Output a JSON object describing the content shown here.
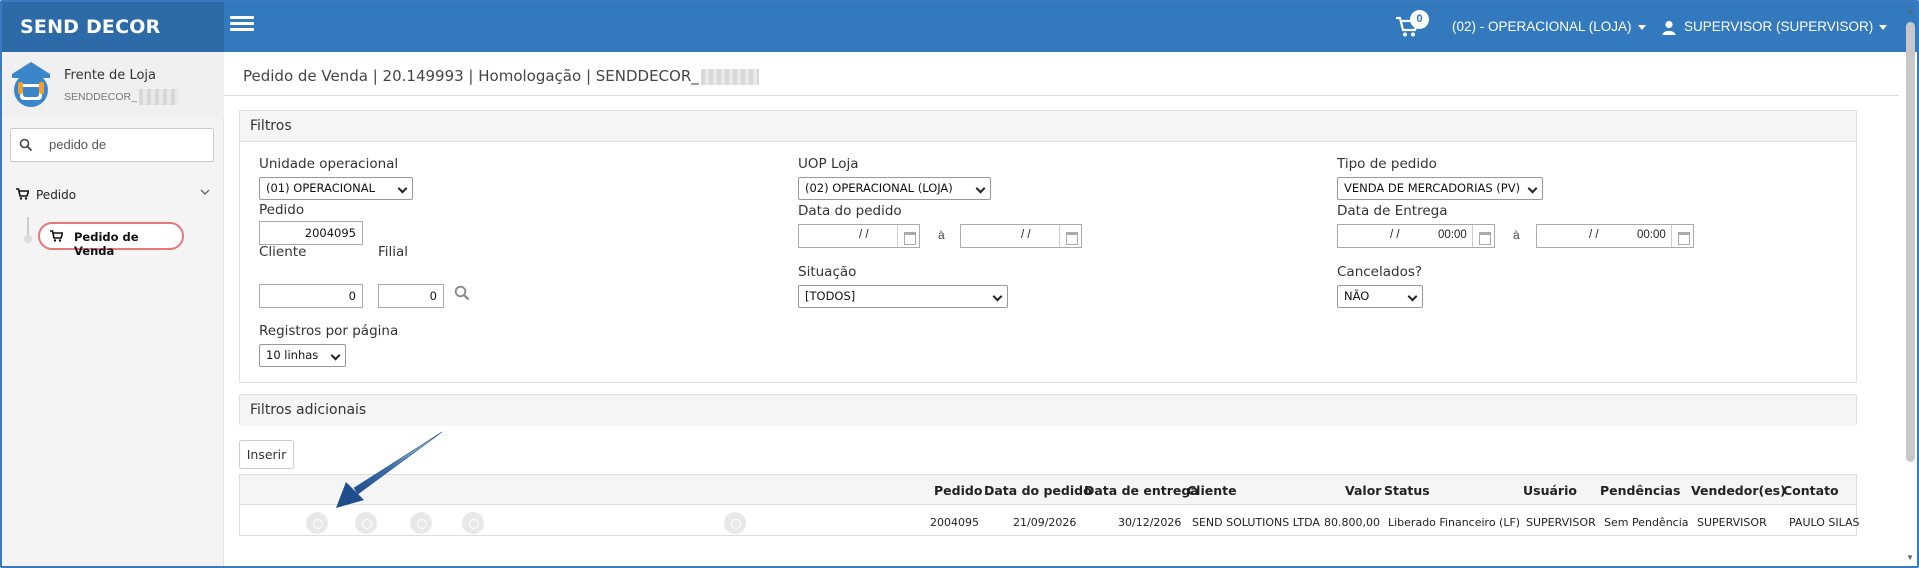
{
  "app": {
    "brand": "SEND DECOR"
  },
  "topbar": {
    "cart_count": "0",
    "uop": "(02) - OPERACIONAL (LOJA)",
    "user": "SUPERVISOR (SUPERVISOR)"
  },
  "sidebar": {
    "store_title": "Frente de Loja",
    "store_sub": "SENDDECOR_",
    "search_value": "pedido de",
    "group_label": "Pedido",
    "active_item": "Pedido de Venda"
  },
  "page": {
    "breadcrumb": "Pedido de Venda | 20.149993 | Homologação | SENDDECOR_"
  },
  "filters": {
    "title": "Filtros",
    "unidade_label": "Unidade operacional",
    "unidade_value": "(01) OPERACIONAL",
    "uop_loja_label": "UOP Loja",
    "uop_loja_value": "(02) OPERACIONAL (LOJA)",
    "tipo_label": "Tipo de pedido",
    "tipo_value": "VENDA DE MERCADORIAS (PV)",
    "pedido_label": "Pedido",
    "pedido_value": "2004095",
    "data_pedido_label": "Data do pedido",
    "date_placeholder": "/ /",
    "time_value": "00:00",
    "a_sep": "à",
    "data_entrega_label": "Data de Entrega",
    "cliente_label": "Cliente",
    "cliente_value": "0",
    "filial_label": "Filial",
    "filial_value": "0",
    "situacao_label": "Situação",
    "situacao_value": "[TODOS]",
    "cancelados_label": "Cancelados?",
    "cancelados_value": "NÃO",
    "registros_label": "Registros por página",
    "registros_value": "10 linhas"
  },
  "additional": {
    "title": "Filtros adicionais"
  },
  "actions": {
    "inserir": "Inserir"
  },
  "table": {
    "headers": [
      "Pedido",
      "Data do pedido",
      "Data de entrega",
      "Cliente",
      "Valor",
      "Status",
      "Usuário",
      "Pendências",
      "Vendedor(es)",
      "Contato"
    ],
    "rows": [
      [
        "2004095",
        "21/09/2026",
        "30/12/2026",
        "SEND SOLUTIONS LTDA",
        "80.800,00",
        "Liberado Financeiro (LF)",
        "SUPERVISOR",
        "Sem Pendência",
        "SUPERVISOR",
        "PAULO SILAS"
      ]
    ]
  },
  "colors": {
    "topbar": "#3379bd",
    "brand_bg": "#2c6aa8",
    "highlight": "#e8777b",
    "arrow": "#1f4e8c"
  }
}
